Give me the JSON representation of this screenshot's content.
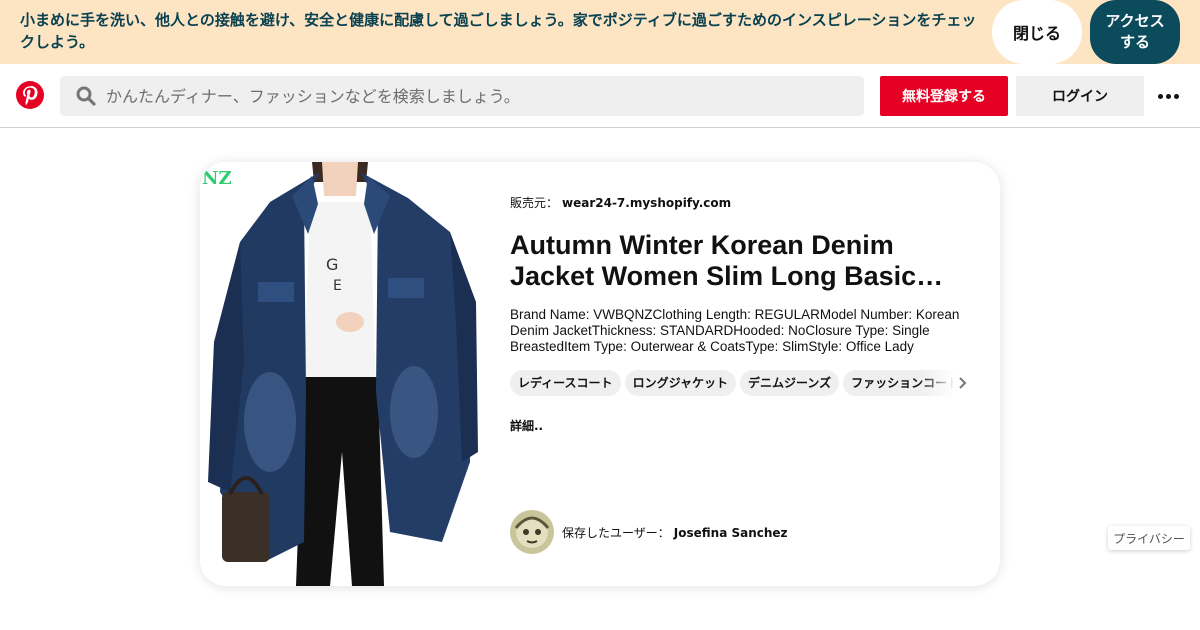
{
  "banner": {
    "message": "小まめに手を洗い、他人との接触を避け、安全と健康に配慮して過ごしましょう。家でポジティブに過ごすためのインスピレーションをチェックしよう。",
    "close_label": "閉じる",
    "access_label": "アクセスする"
  },
  "header": {
    "logo_icon": "pinterest-logo-icon",
    "search_placeholder": "かんたんディナー、ファッションなどを検索しましょう。",
    "signup_label": "無料登録する",
    "login_label": "ログイン",
    "brand_color": "#e60023"
  },
  "pin": {
    "image_badge": "NZ",
    "source_prefix": "販売元：",
    "source": "wear24-7.myshopify.com",
    "title": "Autumn Winter Korean Denim Jacket Women Slim Long Basic Coat",
    "description": "Brand Name: VWBQNZClothing Length: REGULARModel Number: Korean Denim JacketThickness: STANDARDHooded: NoClosure Type: Single BreastedItem Type: Outerwear & CoatsType: SlimStyle: Office Lady",
    "tags": [
      "レディースコート",
      "ロングジャケット",
      "デニムジーンズ",
      "ファッションコート"
    ],
    "more_label": "詳細..",
    "saved_by_prefix": "保存したユーザー：",
    "saved_by": "Josefina Sanchez"
  },
  "privacy_label": "プライバシー"
}
